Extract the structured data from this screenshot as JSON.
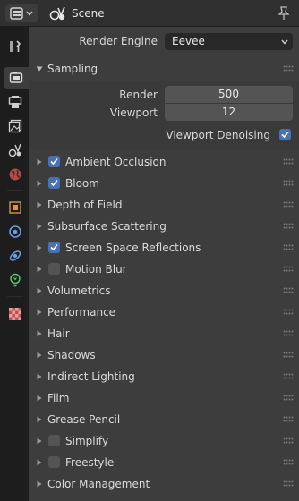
{
  "header": {
    "title": "Scene"
  },
  "render_engine": {
    "label": "Render Engine",
    "value": "Eevee"
  },
  "sampling": {
    "title": "Sampling",
    "render_label": "Render",
    "render_value": "500",
    "viewport_label": "Viewport",
    "viewport_value": "12",
    "denoise_label": "Viewport Denoising",
    "denoise_checked": true
  },
  "panels": [
    {
      "title": "Ambient Occlusion",
      "checkbox": true,
      "checked": true
    },
    {
      "title": "Bloom",
      "checkbox": true,
      "checked": true
    },
    {
      "title": "Depth of Field",
      "checkbox": false
    },
    {
      "title": "Subsurface Scattering",
      "checkbox": false
    },
    {
      "title": "Screen Space Reflections",
      "checkbox": true,
      "checked": true
    },
    {
      "title": "Motion Blur",
      "checkbox": true,
      "checked": false
    },
    {
      "title": "Volumetrics",
      "checkbox": false
    },
    {
      "title": "Performance",
      "checkbox": false
    },
    {
      "title": "Hair",
      "checkbox": false
    },
    {
      "title": "Shadows",
      "checkbox": false
    },
    {
      "title": "Indirect Lighting",
      "checkbox": false
    },
    {
      "title": "Film",
      "checkbox": false
    },
    {
      "title": "Grease Pencil",
      "checkbox": false
    },
    {
      "title": "Simplify",
      "checkbox": true,
      "checked": false
    },
    {
      "title": "Freestyle",
      "checkbox": true,
      "checked": false
    },
    {
      "title": "Color Management",
      "checkbox": false
    }
  ],
  "tabs": [
    {
      "name": "tab-tool",
      "icon": "wrench-screwdriver-icon",
      "color": "#cfcfcf"
    },
    {
      "name": "tab-render",
      "icon": "camera-back-icon",
      "color": "#cfcfcf",
      "active": true
    },
    {
      "name": "tab-output",
      "icon": "printer-icon",
      "color": "#cfcfcf"
    },
    {
      "name": "tab-view-layer",
      "icon": "image-stack-icon",
      "color": "#cfcfcf"
    },
    {
      "name": "tab-scene",
      "icon": "scene-icon",
      "color": "#cfcfcf"
    },
    {
      "name": "tab-world",
      "icon": "world-icon",
      "color": "#e05050"
    },
    {
      "name": "tab-object",
      "icon": "object-square-icon",
      "color": "#e0913c"
    },
    {
      "name": "tab-modifier",
      "icon": "modifier-icon",
      "color": "#6b9be0"
    },
    {
      "name": "tab-physics",
      "icon": "orbit-icon",
      "color": "#6b9be0"
    },
    {
      "name": "tab-object-data",
      "icon": "lightbulb-icon",
      "color": "#59c275"
    },
    {
      "name": "tab-texture",
      "icon": "checker-texture-icon",
      "color": "#e05a5a"
    }
  ],
  "colors": {
    "accent": "#4772b3",
    "panel_bg": "#3d3d3d",
    "sidebar_bg": "#1d1d1d"
  }
}
